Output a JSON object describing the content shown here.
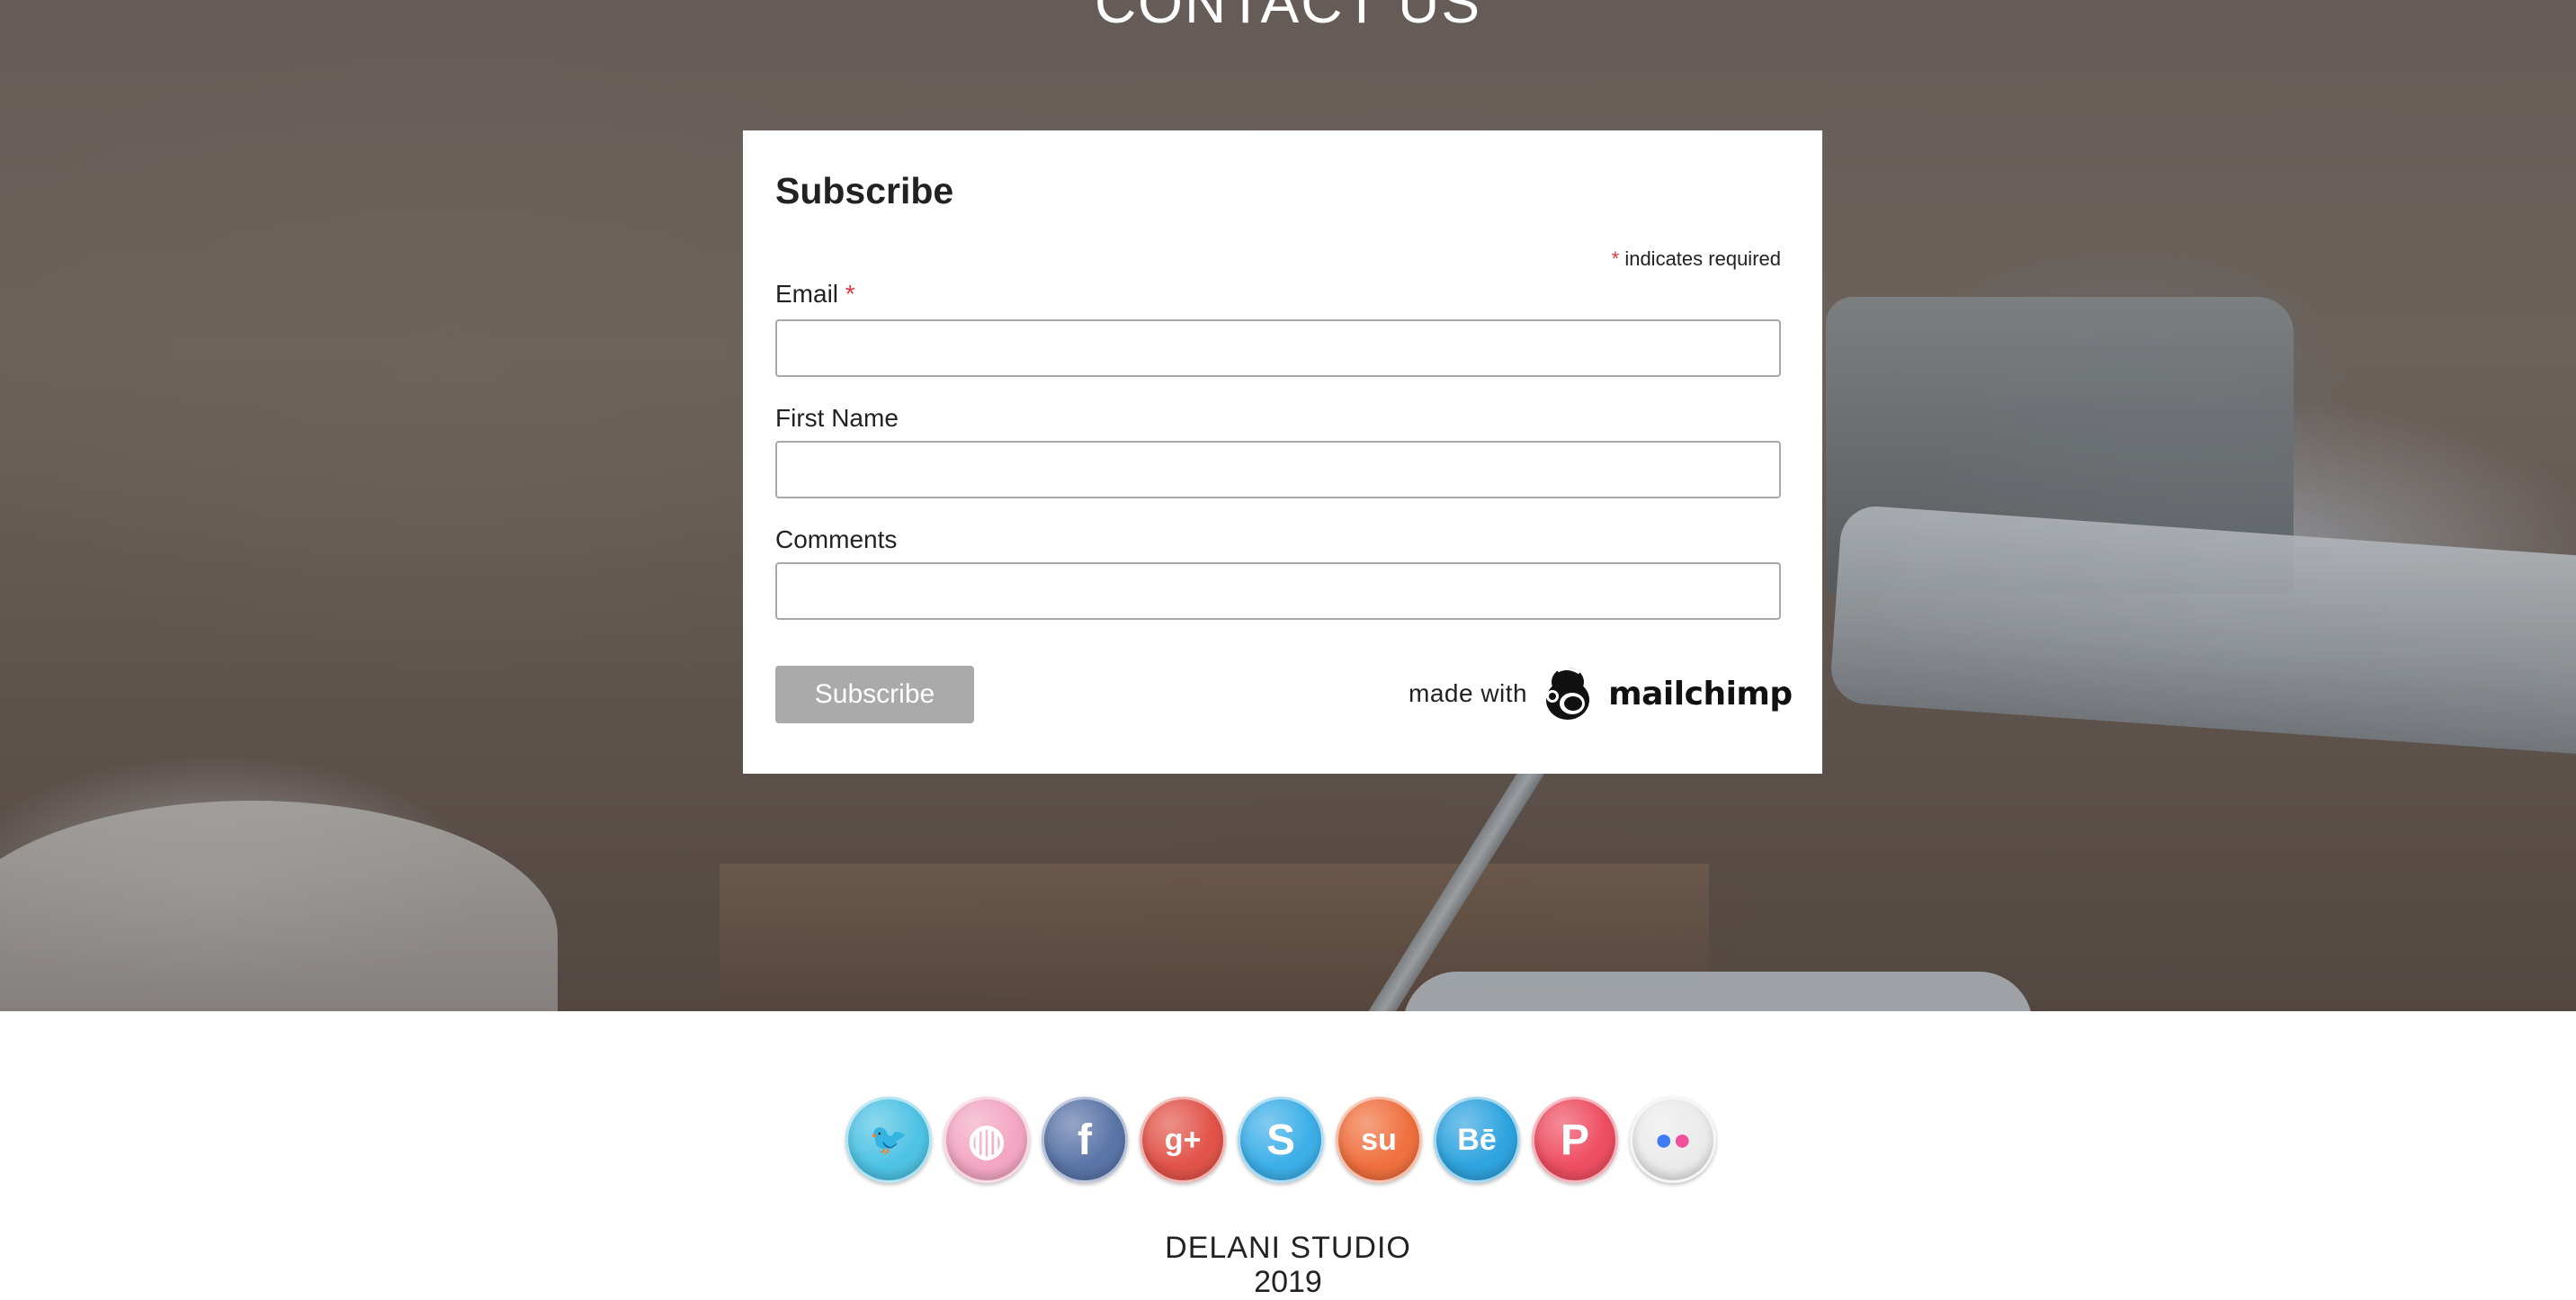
{
  "hero": {
    "title": "CONTACT US"
  },
  "form": {
    "heading": "Subscribe",
    "required_asterisk": "*",
    "required_note": "indicates required",
    "email_label": "Email",
    "email_value": "",
    "first_name_label": "First Name",
    "first_name_value": "",
    "comments_label": "Comments",
    "comments_value": "",
    "submit_label": "Subscribe",
    "made_with_text": "made with",
    "mailchimp_wordmark": "mailchimp"
  },
  "social": {
    "icons": [
      {
        "name": "twitter-icon",
        "glyph": "🐦",
        "color": "#4fc3e4"
      },
      {
        "name": "dribbble-icon",
        "glyph": "◍",
        "color": "#f3a7c2"
      },
      {
        "name": "facebook-icon",
        "glyph": "f",
        "color": "#5b75a8"
      },
      {
        "name": "google-plus-icon",
        "glyph": "g+",
        "color": "#e2544a"
      },
      {
        "name": "skype-icon",
        "glyph": "S",
        "color": "#3dafe8"
      },
      {
        "name": "stumbleupon-icon",
        "glyph": "su",
        "color": "#f0703f"
      },
      {
        "name": "behance-icon",
        "glyph": "Bē",
        "color": "#2fa4df"
      },
      {
        "name": "pinterest-icon",
        "glyph": "P",
        "color": "#ee4e62"
      },
      {
        "name": "flickr-icon",
        "glyph": "●●",
        "color": "#ebebeb"
      }
    ]
  },
  "footer": {
    "studio_name": "DELANI STUDIO",
    "year": "2019"
  }
}
